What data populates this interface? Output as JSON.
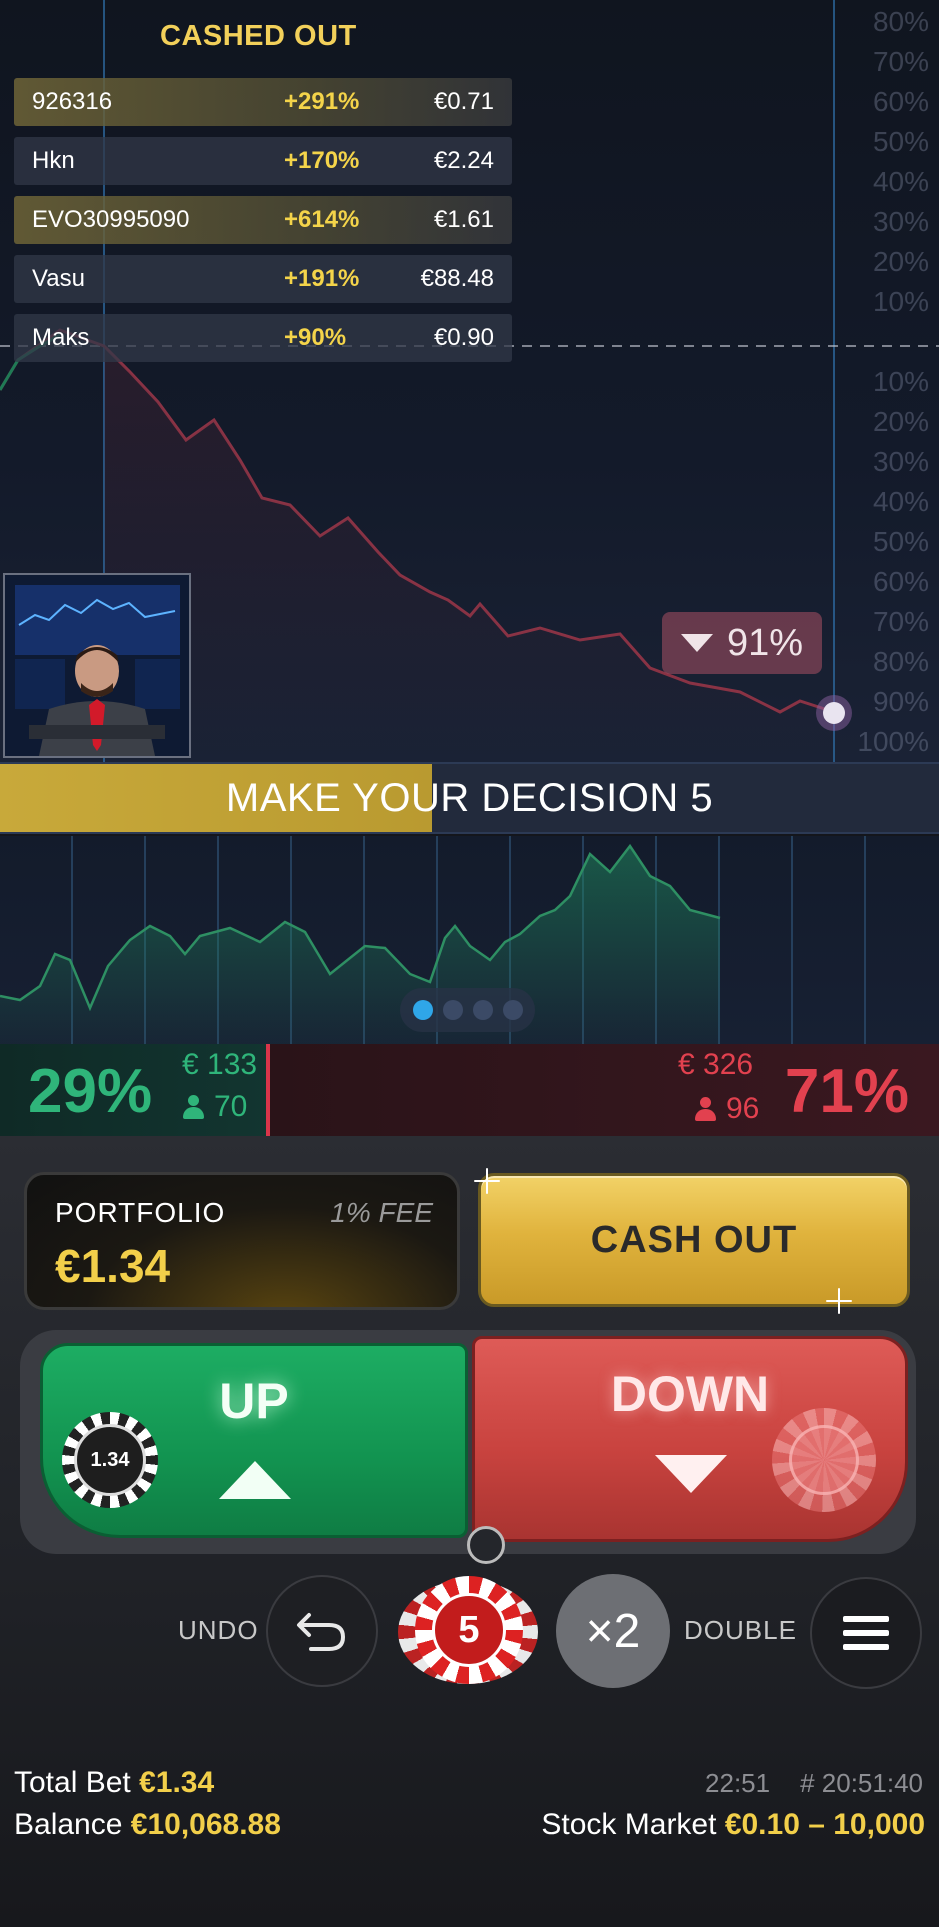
{
  "cashed_out": {
    "title": "CASHED OUT",
    "rows": [
      {
        "name": "926316",
        "percent": "+291%",
        "amount": "€0.71",
        "highlight": true
      },
      {
        "name": "Hkn",
        "percent": "+170%",
        "amount": "€2.24",
        "highlight": false
      },
      {
        "name": "EVO30995090",
        "percent": "+614%",
        "amount": "€1.61",
        "highlight": true
      },
      {
        "name": "Vasu",
        "percent": "+191%",
        "amount": "€88.48",
        "highlight": false
      },
      {
        "name": "Maks",
        "percent": "+90%",
        "amount": "€0.90",
        "highlight": false
      }
    ]
  },
  "price_scale": {
    "up_labels": [
      "80%",
      "70%",
      "60%",
      "50%",
      "40%",
      "30%",
      "20%",
      "10%"
    ],
    "down_labels": [
      "10%",
      "20%",
      "30%",
      "40%",
      "50%",
      "60%",
      "70%",
      "80%",
      "90%",
      "100%"
    ]
  },
  "indicator": {
    "value": "91%",
    "direction": "down"
  },
  "decision": {
    "label": "MAKE YOUR DECISION 5",
    "progress": 0.46
  },
  "pagination": {
    "count": 4,
    "active": 0
  },
  "sentiment": {
    "up": {
      "percent": "29%",
      "amount": "€ 133",
      "players": "70"
    },
    "down": {
      "percent": "71%",
      "amount": "€ 326",
      "players": "96"
    }
  },
  "portfolio": {
    "label": "PORTFOLIO",
    "fee": "1% FEE",
    "value": "€1.34"
  },
  "cash_out_label": "CASH OUT",
  "up_button": {
    "label": "UP",
    "chip_value": "1.34"
  },
  "down_button": {
    "label": "DOWN"
  },
  "controls": {
    "undo_label": "UNDO",
    "chip_value": "5",
    "double_symbol": "×2",
    "double_label": "DOUBLE"
  },
  "footer": {
    "total_bet_label": "Total Bet",
    "total_bet_value": "€1.34",
    "balance_label": "Balance",
    "balance_value": "€10,068.88",
    "time": "22:51",
    "round_id": "# 20:51:40",
    "market_label": "Stock Market",
    "market_range": "€0.10 – 10,000"
  },
  "colors": {
    "gold": "#f2cf4a",
    "up_green": "#2fb57a",
    "down_red": "#e2414f",
    "active_dot": "#2fa6e8"
  }
}
